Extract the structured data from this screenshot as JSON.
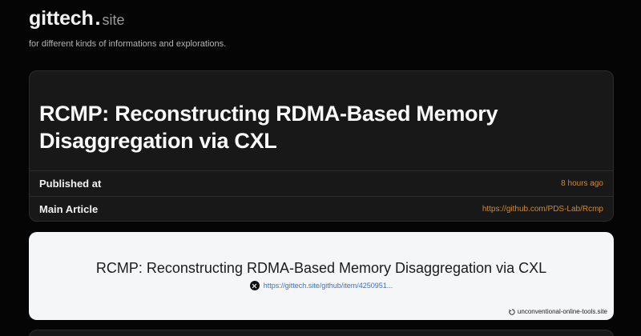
{
  "site": {
    "brand_name": "gittech",
    "brand_dot": ".",
    "brand_suffix": "site",
    "tagline": "for different kinds of informations and explorations."
  },
  "article": {
    "title": "RCMP: Reconstructing RDMA-Based Memory Disaggregation via CXL",
    "published_label": "Published at",
    "published_value": "8 hours ago",
    "main_article_label": "Main Article",
    "main_article_value": "https://github.com/PDS-Lab/Rcmp"
  },
  "preview": {
    "title": "RCMP: Reconstructing RDMA-Based Memory Disaggregation via CXL",
    "link": "https://gittech.site/github/item/4250951...",
    "link_icon": "x-icon",
    "footer_text": "unconventional-online-tools.site",
    "footer_icon": "tool-icon"
  },
  "colors": {
    "background": "#050505",
    "card": "#181818",
    "accent": "#d4882a",
    "preview_background": "#f5f6f8",
    "preview_link": "#3a6fc4"
  }
}
